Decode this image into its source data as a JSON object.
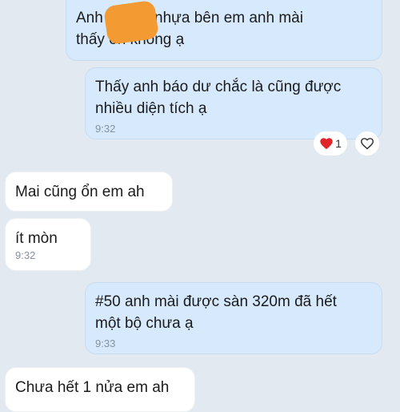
{
  "colors": {
    "background": "#e2e9f1",
    "outgoing_bubble": "#d7eafd",
    "incoming_bubble": "#ffffff",
    "timestamp": "#8591a0",
    "redaction": "#f39a33",
    "heart": "#e0242a"
  },
  "messages": [
    {
      "direction": "outgoing",
      "text": "Anh      ơi, đĩa nhựa bên em anh mài\nthấy ổn không ạ",
      "time": ""
    },
    {
      "direction": "outgoing",
      "text": "Thấy anh báo dư chắc là cũng được\nnhiều diện tích ạ",
      "time": "9:32"
    },
    {
      "direction": "incoming",
      "text": "Mai cũng ổn em ah",
      "time": ""
    },
    {
      "direction": "incoming",
      "text": "ít mòn",
      "time": "9:32"
    },
    {
      "direction": "outgoing",
      "text": "#50 anh mài được sàn 320m đã hết\nmột bộ chưa ạ",
      "time": "9:33"
    },
    {
      "direction": "incoming",
      "text": "Chưa hết 1 nửa em ah",
      "time": ""
    }
  ],
  "reactions": {
    "heart_count": "1",
    "heart_icon": "filled-heart",
    "add_reaction_icon": "outline-heart"
  }
}
